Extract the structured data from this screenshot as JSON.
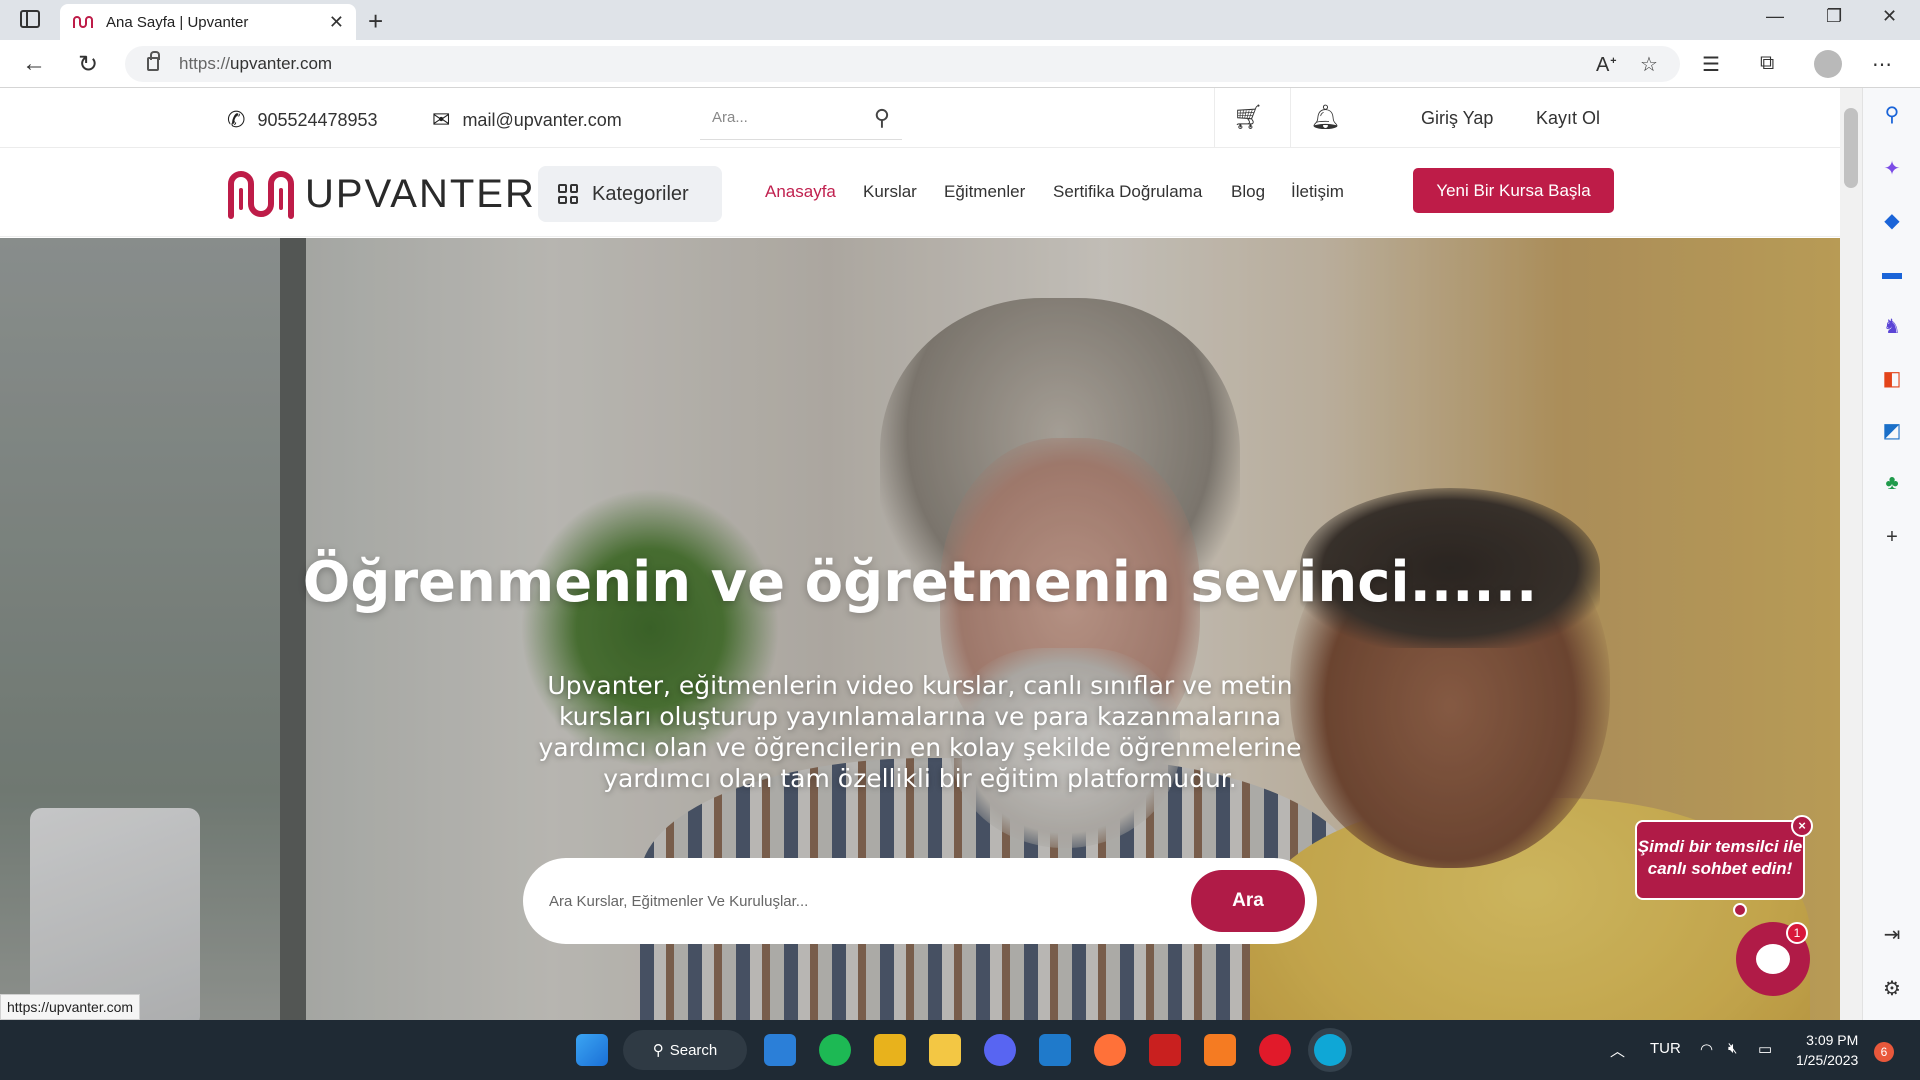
{
  "browser": {
    "tab_title": "Ana Sayfa | Upvanter",
    "url_prefix": "https://",
    "url_host": "upvanter.com",
    "status_url": "https://upvanter.com"
  },
  "topbar": {
    "phone": "905524478953",
    "email": "mail@upvanter.com",
    "search_placeholder": "Ara...",
    "login": "Giriş Yap",
    "register": "Kayıt Ol"
  },
  "nav": {
    "logo_text": "UPVANTER",
    "categories": "Kategoriler",
    "items": [
      {
        "label": "Anasayfa",
        "active": true
      },
      {
        "label": "Kurslar"
      },
      {
        "label": "Eğitmenler"
      },
      {
        "label": "Sertifika Doğrulama"
      },
      {
        "label": "Blog"
      },
      {
        "label": "İletişim"
      }
    ],
    "cta": "Yeni Bir Kursa Başla"
  },
  "hero": {
    "title": "Öğrenmenin ve öğretmenin sevinci......",
    "description": "Upvanter, eğitmenlerin video kurslar, canlı sınıflar ve metin kursları oluşturup yayınlamalarına ve para kazanmalarına yardımcı olan ve öğrencilerin en kolay şekilde öğrenmelerine yardımcı olan tam özellikli bir eğitim platformudur.",
    "search_placeholder": "Ara Kurslar, Eğitmenler Ve Kuruluşlar...",
    "search_button": "Ara"
  },
  "chat": {
    "bubble_text": "Şimdi bir temsilci ile canlı sohbet edin!",
    "close": "×",
    "badge": "1"
  },
  "taskbar": {
    "search_label": "Search",
    "language": "TUR",
    "time": "3:09 PM",
    "date": "1/25/2023",
    "notifications": "6"
  },
  "colors": {
    "brand": "#be1c48",
    "taskbar": "#1f2a34"
  }
}
